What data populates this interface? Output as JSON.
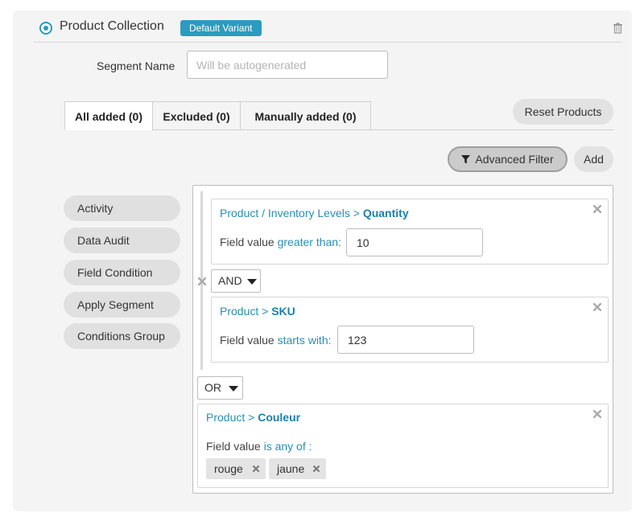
{
  "header": {
    "title": "Product Collection",
    "badge": "Default Variant"
  },
  "segment": {
    "label": "Segment Name",
    "placeholder": "Will be autogenerated",
    "value": ""
  },
  "tabs": [
    {
      "label": "All added (0)",
      "active": true
    },
    {
      "label": "Excluded (0)",
      "active": false
    },
    {
      "label": "Manually added (0)",
      "active": false
    }
  ],
  "actions": {
    "reset": "Reset Products",
    "advanced_filter": "Advanced Filter",
    "add": "Add"
  },
  "sidebar": {
    "items": [
      {
        "label": "Activity"
      },
      {
        "label": "Data Audit"
      },
      {
        "label": "Field Condition"
      },
      {
        "label": "Apply Segment"
      },
      {
        "label": "Conditions Group"
      }
    ]
  },
  "conditions": {
    "group": {
      "first": {
        "path": "Product / Inventory Levels > ",
        "field": "Quantity",
        "label": "Field value ",
        "operator": "greater than:",
        "value": "10"
      },
      "logic": "AND",
      "second": {
        "path": "Product > ",
        "field": "SKU",
        "label": "Field value ",
        "operator": "starts with:",
        "value": "123"
      }
    },
    "outer_logic": "OR",
    "third": {
      "path": "Product > ",
      "field": "Couleur",
      "label": "Field value ",
      "operator": "is any of :",
      "tags": [
        "rouge",
        "jaune"
      ]
    }
  },
  "colors": {
    "accent": "#2b9bbf",
    "link": "#2a8db5",
    "card_bg": "#f4f4f4",
    "pill_bg": "#e0e0e0"
  },
  "icons": {
    "trash": "trash-icon",
    "filter": "filter-icon",
    "close": "close-icon",
    "caret": "caret-down-icon"
  }
}
